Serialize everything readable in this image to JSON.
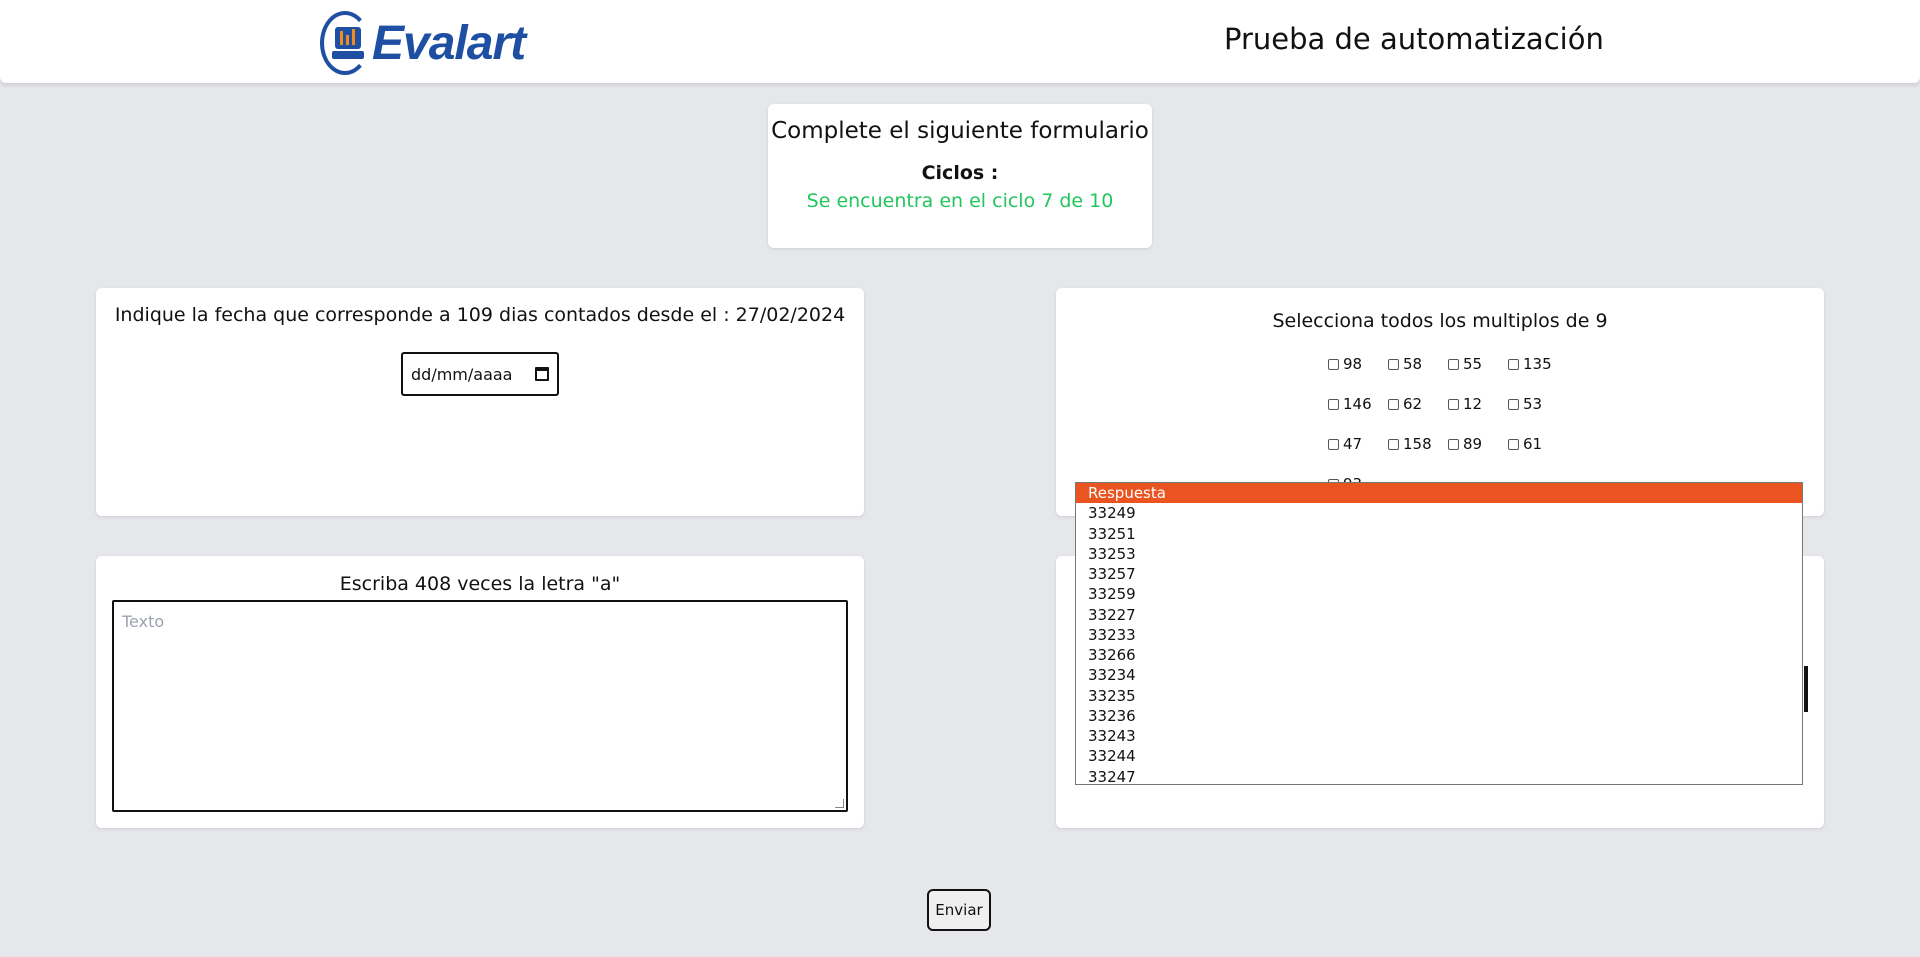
{
  "header": {
    "logo_text": "Evalart",
    "title": "Prueba de automatización"
  },
  "status": {
    "heading": "Complete el siguiente formulario",
    "cycles_label": "Ciclos :",
    "cycles_value": "Se encuentra en el ciclo 7 de 10"
  },
  "date_question": {
    "label": "Indique la fecha que corresponde a 109 dias contados desde el : 27/02/2024",
    "placeholder": "dd/mm/aaaa"
  },
  "multiples_question": {
    "label": "Selecciona todos los multiplos de 9",
    "options": [
      "98",
      "58",
      "55",
      "135",
      "146",
      "62",
      "12",
      "53",
      "47",
      "158",
      "89",
      "61",
      "93"
    ]
  },
  "text_question": {
    "label": "Escriba 408 veces la letra \"a\"",
    "placeholder": "Texto"
  },
  "select_dropdown": {
    "options": [
      "Respuesta",
      "33249",
      "33251",
      "33253",
      "33257",
      "33259",
      "33227",
      "33233",
      "33266",
      "33234",
      "33235",
      "33236",
      "33243",
      "33244",
      "33247"
    ],
    "selected": "Respuesta",
    "highlight_color": "#e95420"
  },
  "submit_label": "Enviar",
  "colors": {
    "accent_green": "#22c55e",
    "brand_blue": "#1e4fa3",
    "background": "#e5e7eb"
  }
}
